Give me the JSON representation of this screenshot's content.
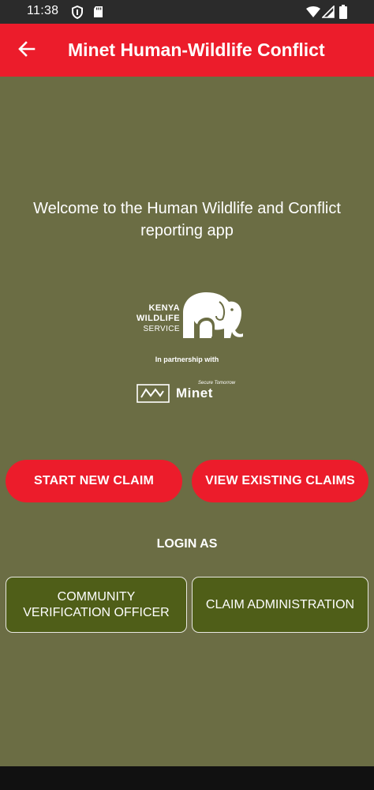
{
  "status_bar": {
    "time": "11:38",
    "icons": [
      "shield-icon",
      "sd-card-icon",
      "wifi-icon",
      "signal-icon",
      "battery-icon"
    ]
  },
  "app_bar": {
    "title": "Minet Human-Wildlife Conflict",
    "back_icon": "arrow-left-icon"
  },
  "welcome": {
    "text": "Welcome to the Human Wildlife and Conflict reporting app"
  },
  "kws_logo": {
    "line1": "KENYA",
    "line2": "WILDLIFE",
    "line3": "SERVICE"
  },
  "partnership": "In partnership with",
  "minet_logo": {
    "tagline": "Secure Tomorrow",
    "word": "Minet"
  },
  "actions": {
    "start_new_claim": "START NEW CLAIM",
    "view_existing_claims": "VIEW EXISTING CLAIMS"
  },
  "login": {
    "heading": "LOGIN AS",
    "community_verification_officer": "COMMUNITY VERIFICATION OFFICER",
    "claim_administration": "CLAIM ADMINISTRATION"
  },
  "colors": {
    "background": "#6b6d44",
    "app_bar": "#ec1c2b",
    "primary_button": "#ec1c2b",
    "login_button": "#4f5e18",
    "status_bar": "#2b2b2b"
  }
}
